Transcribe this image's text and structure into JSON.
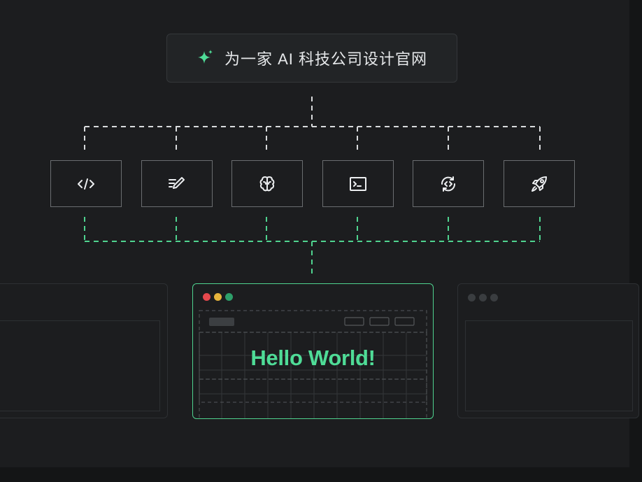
{
  "prompt": {
    "icon": "sparkle-icon",
    "text": "为一家 AI 科技公司设计官网"
  },
  "tools": [
    {
      "name": "code-icon"
    },
    {
      "name": "edit-notes-icon"
    },
    {
      "name": "brain-icon"
    },
    {
      "name": "terminal-icon"
    },
    {
      "name": "refresh-code-icon"
    },
    {
      "name": "rocket-icon"
    }
  ],
  "preview": {
    "headline": "Hello World!"
  },
  "colors": {
    "accent": "#4fdc97",
    "dot_red": "#e5484d",
    "dot_yellow": "#e6b43c",
    "dot_green": "#2e9f6a"
  }
}
